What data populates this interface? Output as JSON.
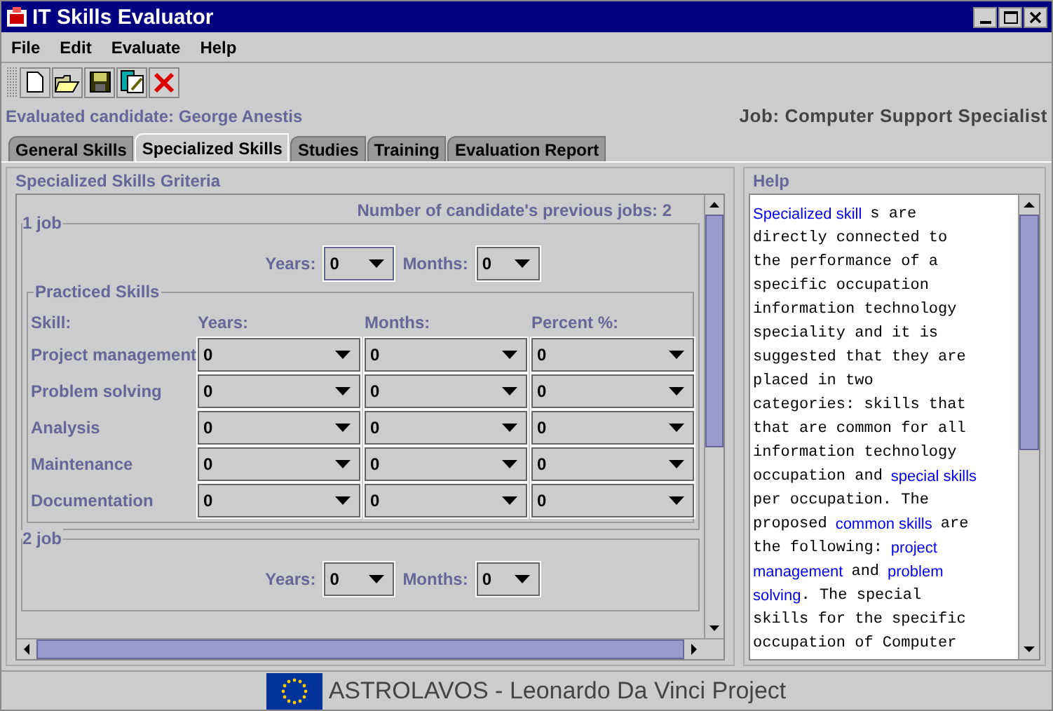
{
  "window": {
    "title": "IT Skills Evaluator"
  },
  "menu": [
    "File",
    "Edit",
    "Evaluate",
    "Help"
  ],
  "candidate": "Evaluated candidate: George Anestis",
  "job": "Job: Computer Support Specialist",
  "tabs": [
    {
      "label": "General Skills",
      "selected": false
    },
    {
      "label": "Specialized Skills",
      "selected": true
    },
    {
      "label": "Studies",
      "selected": false
    },
    {
      "label": "Training",
      "selected": false
    },
    {
      "label": "Evaluation Report",
      "selected": false
    }
  ],
  "criteria": {
    "title": "Specialized Skills Griteria",
    "jobs_count": "Number of candidate's previous jobs: 2",
    "jobs": [
      {
        "title": "1 job",
        "years_label": "Years:",
        "years": "0",
        "months_label": "Months:",
        "months": "0",
        "focused": true,
        "skills": {
          "title": "Practiced Skills",
          "columns": [
            "Skill:",
            "Years:",
            "Months:",
            "Percent %:"
          ],
          "rows": [
            {
              "skill": "Project management",
              "years": "0",
              "months": "0",
              "percent": "0"
            },
            {
              "skill": "Problem solving",
              "years": "0",
              "months": "0",
              "percent": "0"
            },
            {
              "skill": "Analysis",
              "years": "0",
              "months": "0",
              "percent": "0"
            },
            {
              "skill": "Maintenance",
              "years": "0",
              "months": "0",
              "percent": "0"
            },
            {
              "skill": "Documentation",
              "years": "0",
              "months": "0",
              "percent": "0"
            }
          ]
        }
      },
      {
        "title": "2 job",
        "years_label": "Years:",
        "years": "0",
        "months_label": "Months:",
        "months": "0",
        "focused": false
      }
    ]
  },
  "help": {
    "title": "Help",
    "lines": [
      [
        {
          "kind": "link",
          "text": "Specialized skill"
        },
        {
          "kind": "text",
          "text": "s are"
        }
      ],
      [
        {
          "kind": "text",
          "text": "directly connected to"
        }
      ],
      [
        {
          "kind": "text",
          "text": "the performance of a"
        }
      ],
      [
        {
          "kind": "text",
          "text": "specific occupation"
        }
      ],
      [
        {
          "kind": "text",
          "text": "information technology"
        }
      ],
      [
        {
          "kind": "text",
          "text": "speciality and it is"
        }
      ],
      [
        {
          "kind": "text",
          "text": "suggested that they are"
        }
      ],
      [
        {
          "kind": "text",
          "text": "placed in two"
        }
      ],
      [
        {
          "kind": "text",
          "text": "categories: skills that"
        }
      ],
      [
        {
          "kind": "text",
          "text": "that are common for all"
        }
      ],
      [
        {
          "kind": "text",
          "text": "information technology"
        }
      ],
      [
        {
          "kind": "text",
          "text": "occupation and"
        },
        {
          "kind": "link",
          "text": "special skills"
        }
      ],
      [
        {
          "kind": "text",
          "text": "per occupation. The"
        }
      ],
      [
        {
          "kind": "text",
          "text": "proposed"
        },
        {
          "kind": "link",
          "text": "common skills"
        },
        {
          "kind": "text",
          "text": "are"
        }
      ],
      [
        {
          "kind": "text",
          "text": "the following:"
        },
        {
          "kind": "link",
          "text": "project"
        }
      ],
      [
        {
          "kind": "link",
          "text": "management"
        },
        {
          "kind": "text",
          "text": "and"
        },
        {
          "kind": "link",
          "text": "problem"
        }
      ],
      [
        {
          "kind": "link",
          "text": "solving"
        },
        {
          "kind": "text",
          "text": ". The special"
        }
      ],
      [
        {
          "kind": "text",
          "text": "skills for the specific"
        }
      ],
      [
        {
          "kind": "text",
          "text": "occupation of Computer"
        }
      ]
    ]
  },
  "footer": "ASTROLAVOS - Leonardo Da Vinci Project"
}
